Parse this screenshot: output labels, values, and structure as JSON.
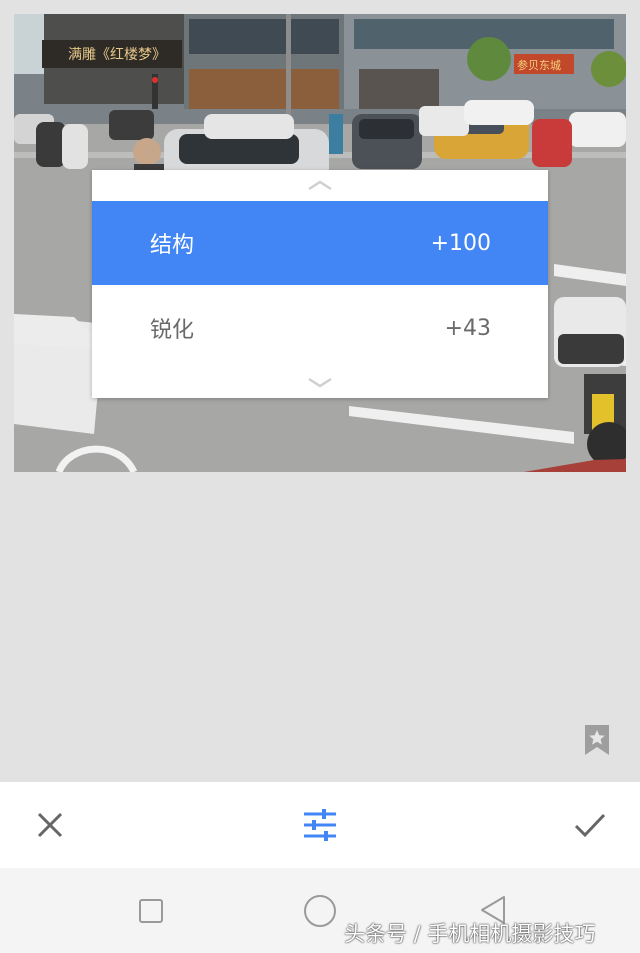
{
  "photo": {
    "shop_sign": "满雕《红楼梦》",
    "roof_sign": "参贝东城"
  },
  "adjust_menu": {
    "items": [
      {
        "label": "结构",
        "value": "+100",
        "selected": true
      },
      {
        "label": "锐化",
        "value": "+43",
        "selected": false
      }
    ]
  },
  "toolbar": {
    "cancel_icon": "close-icon",
    "adjust_icon": "tune-sliders-icon",
    "apply_icon": "checkmark-icon",
    "accent_color": "#4285f4"
  },
  "navbar": {
    "icons": [
      "recents-square-icon",
      "home-circle-icon",
      "back-triangle-icon"
    ]
  },
  "watermark": "头条号 / 手机相机摄影技巧"
}
